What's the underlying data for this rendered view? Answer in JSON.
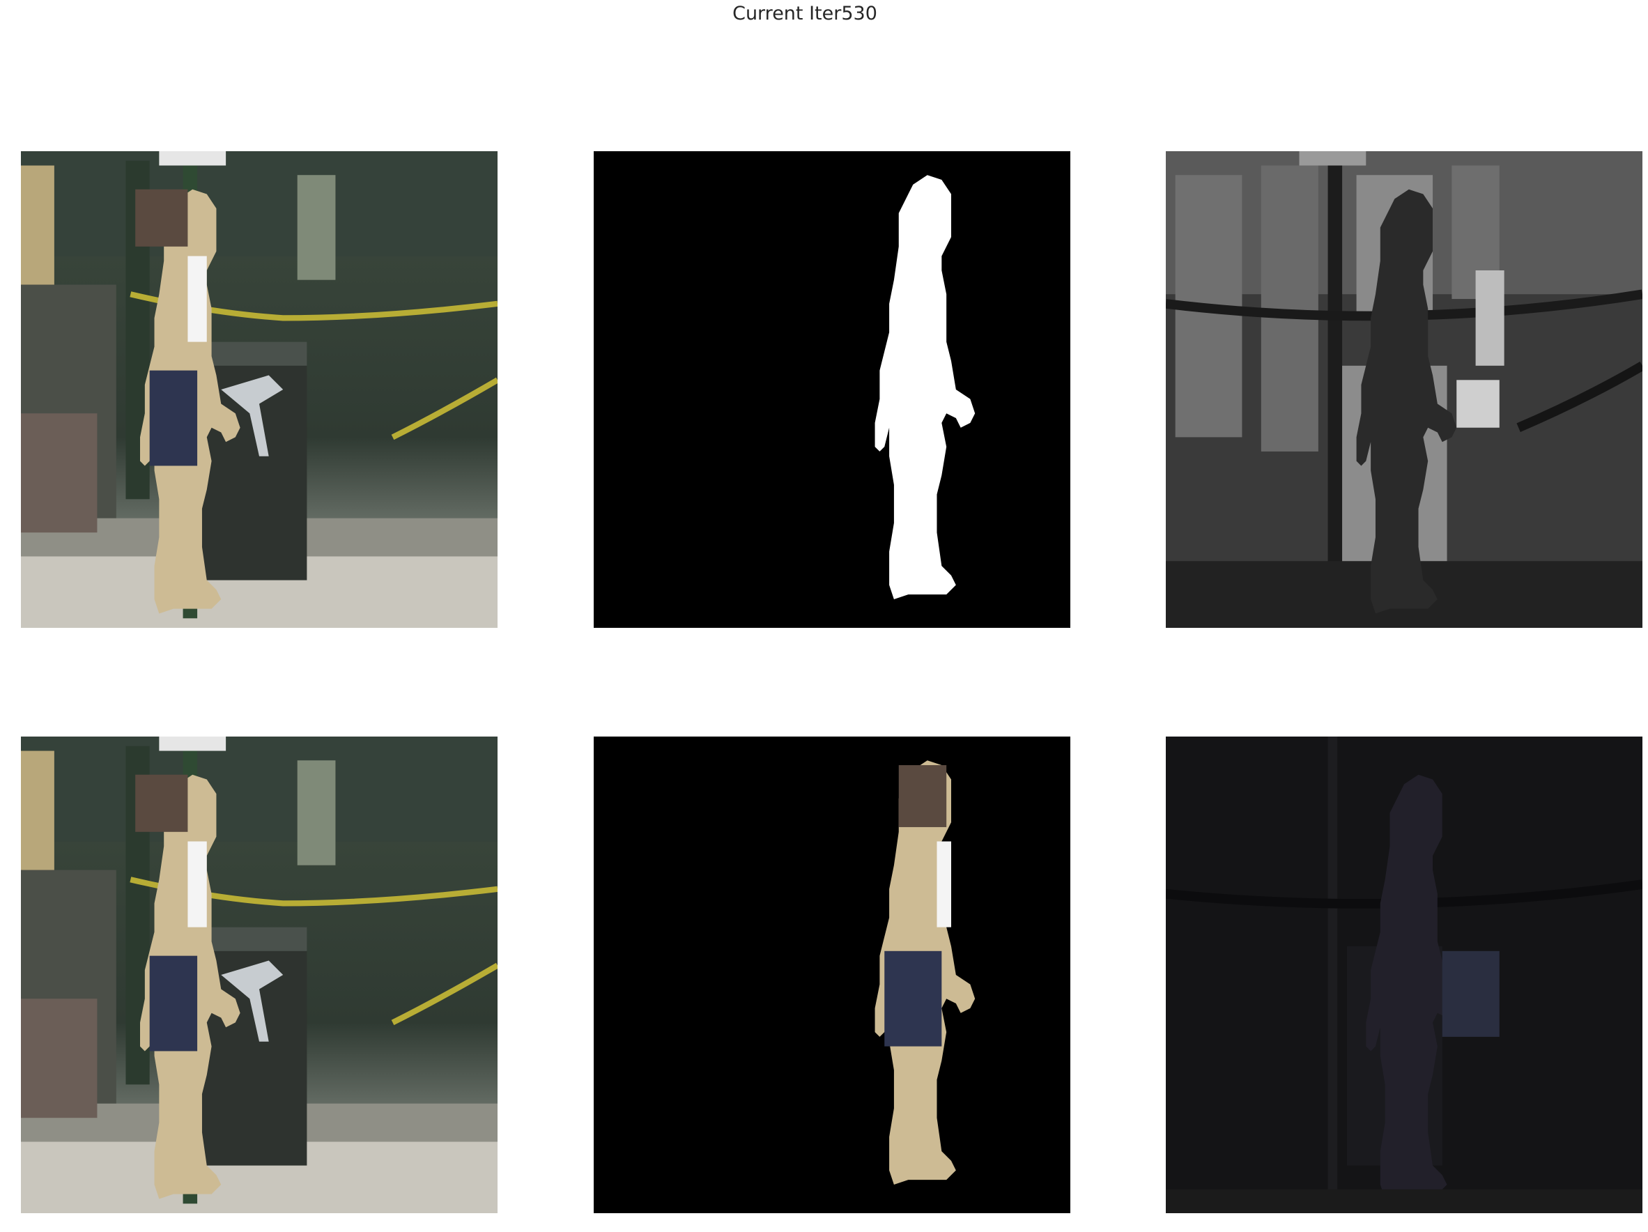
{
  "figure": {
    "title": "Current Iter530"
  },
  "panels": [
    {
      "row": 1,
      "col": 1,
      "content": "input-photo"
    },
    {
      "row": 1,
      "col": 2,
      "content": "binary-mask"
    },
    {
      "row": 1,
      "col": 3,
      "content": "grayscale-feature-map"
    },
    {
      "row": 2,
      "col": 1,
      "content": "input-photo"
    },
    {
      "row": 2,
      "col": 2,
      "content": "masked-foreground"
    },
    {
      "row": 2,
      "col": 3,
      "content": "dark-reconstruction"
    }
  ]
}
